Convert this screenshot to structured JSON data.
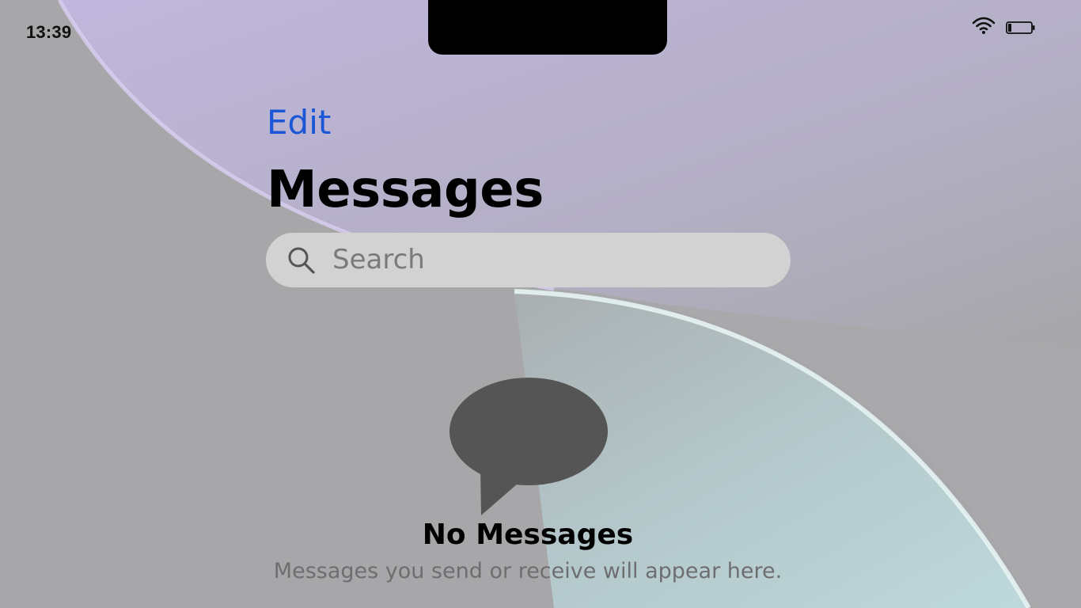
{
  "status_bar": {
    "time": "13:39",
    "wifi_icon": "wifi-icon",
    "battery_icon": "battery-icon"
  },
  "nav": {
    "edit_label": "Edit",
    "title": "Messages"
  },
  "search": {
    "placeholder": "Search",
    "icon": "search-icon"
  },
  "empty_state": {
    "icon": "chat-bubble-icon",
    "title": "No Messages",
    "subtitle": "Messages you send or receive will appear here."
  },
  "colors": {
    "accent": "#1a56d6",
    "background": "#a7a7a9",
    "search_field": "#d2d2d2",
    "bubble": "#555555"
  }
}
